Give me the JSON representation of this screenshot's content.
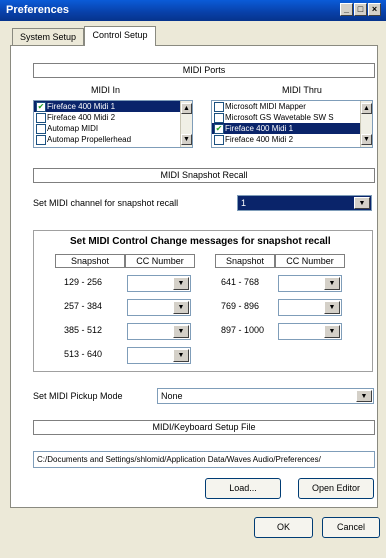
{
  "window": {
    "title": "Preferences",
    "min": "_",
    "max": "□",
    "close": "×"
  },
  "tabs": [
    {
      "label": "System Setup"
    },
    {
      "label": "Control Setup"
    }
  ],
  "midi_ports": {
    "header": "MIDI Ports",
    "in_label": "MIDI In",
    "thru_label": "MIDI Thru",
    "in_items": [
      {
        "label": "Fireface 400 Midi 1",
        "checked": true
      },
      {
        "label": "Fireface 400 Midi 2",
        "checked": false
      },
      {
        "label": "Automap MIDI",
        "checked": false
      },
      {
        "label": "Automap Propellerhead",
        "checked": false
      }
    ],
    "thru_items": [
      {
        "label": "Microsoft MIDI Mapper",
        "checked": false
      },
      {
        "label": "Microsoft GS Wavetable SW S",
        "checked": false
      },
      {
        "label": "Fireface 400 Midi 1",
        "checked": true
      },
      {
        "label": "Fireface 400 Midi 2",
        "checked": false
      }
    ]
  },
  "snapshot": {
    "header": "MIDI Snapshot Recall",
    "channel_label": "Set MIDI channel for snapshot recall",
    "channel_value": "1",
    "cc_title": "Set MIDI Control Change messages for snapshot recall",
    "col_snapshot": "Snapshot",
    "col_cc": "CC Number",
    "left_ranges": [
      "129 - 256",
      "257 - 384",
      "385 - 512",
      "513 - 640"
    ],
    "right_ranges": [
      "641 - 768",
      "769 - 896",
      "897 - 1000"
    ]
  },
  "pickup": {
    "label": "Set MIDI Pickup Mode",
    "value": "None"
  },
  "keyboard": {
    "header": "MIDI/Keyboard Setup File",
    "path": "C:/Documents and Settings/shlomid/Application Data/Waves Audio/Preferences/",
    "load": "Load...",
    "open_editor": "Open Editor"
  },
  "footer": {
    "ok": "OK",
    "cancel": "Cancel"
  },
  "icons": {
    "check": "✔",
    "up": "▲",
    "down": "▼"
  }
}
